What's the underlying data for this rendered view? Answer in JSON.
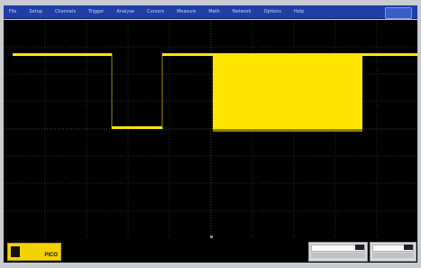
{
  "menubar": {
    "items": [
      "File",
      "Setup",
      "Channels",
      "Trigger",
      "Analyse",
      "Cursors",
      "Measure",
      "Math",
      "Network",
      "Options",
      "Help"
    ]
  },
  "scope": {
    "trace_color": "#ffe600",
    "grid_color": "#3a3a3a",
    "background": "#000000"
  },
  "brand": {
    "name": "PICO"
  },
  "status": {
    "left": "",
    "right": ""
  }
}
